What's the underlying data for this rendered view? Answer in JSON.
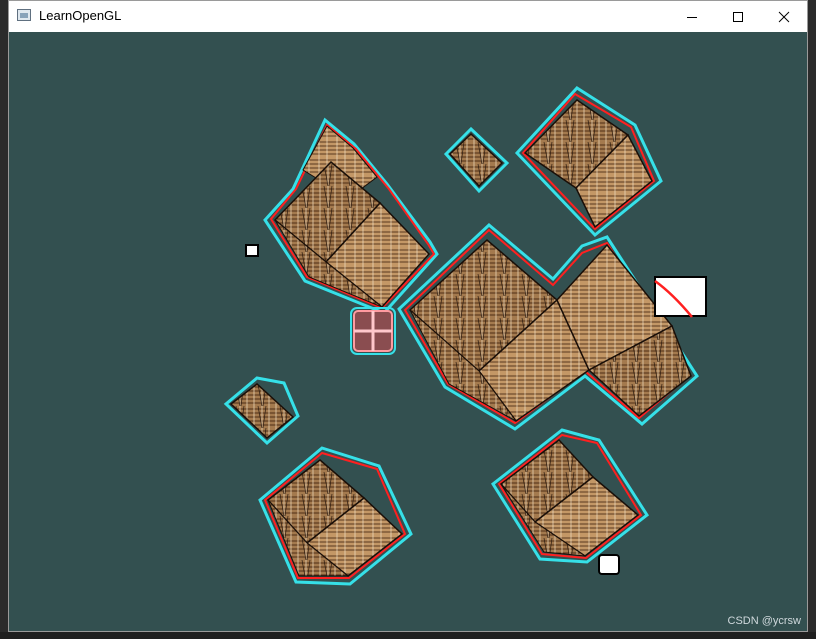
{
  "window": {
    "title": "LearnOpenGL",
    "icon": "app-window-icon",
    "controls": {
      "minimize": "minimize-icon",
      "maximize": "maximize-icon",
      "close": "close-icon"
    }
  },
  "scene": {
    "background_color": "#335050",
    "outline_colors": {
      "cyan": "#36e0e8",
      "red": "#ff2020"
    }
  },
  "watermark": "CSDN @ycrsw"
}
